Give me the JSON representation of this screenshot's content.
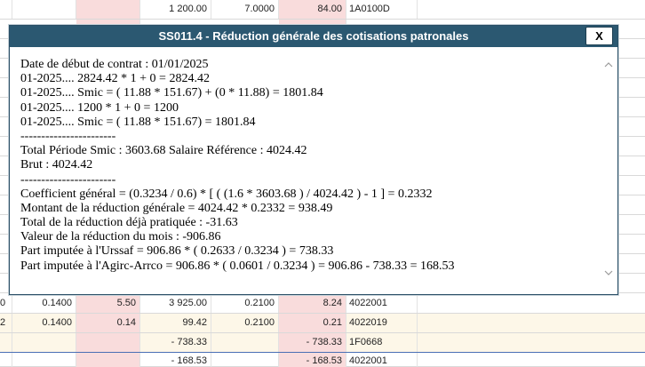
{
  "sheet": {
    "top_row": {
      "c0": "",
      "c3": "1 200.00",
      "c4": "7.0000",
      "c5": "84.00",
      "c6": "1A0100D"
    },
    "bottom_rows": [
      {
        "c0": "0",
        "c1": "0.1400",
        "c2": "5.50",
        "c3": "3 925.00",
        "c4": "0.2100",
        "c5": "8.24",
        "c6": "4022001"
      },
      {
        "c0": "2",
        "c1": "0.1400",
        "c2": "0.14",
        "c3": "99.42",
        "c4": "0.2100",
        "c5": "0.21",
        "c6": "4022019"
      },
      {
        "c0": "",
        "c1": "",
        "c2": "",
        "c3": "- 738.33",
        "c4": "",
        "c5": "- 738.33",
        "c6": "1F0668"
      },
      {
        "c0": "",
        "c1": "",
        "c2": "",
        "c3": "- 168.53",
        "c4": "",
        "c5": "- 168.53",
        "c6": "4022001"
      }
    ]
  },
  "dialog": {
    "title": "SS011.4 - Réduction générale des cotisations patronales",
    "close_label": "X",
    "lines": [
      "Date de début de contrat : 01/01/2025",
      "01-2025.... 2824.42 * 1 + 0 = 2824.42",
      "01-2025.... Smic = ( 11.88 * 151.67) + (0 * 11.88) = 1801.84",
      "01-2025.... 1200 * 1 + 0 = 1200",
      "01-2025.... Smic = ( 11.88 * 151.67) = 1801.84",
      "-----------------------",
      "Total Période Smic : 3603.68 Salaire Référence : 4024.42",
      "Brut : 4024.42",
      "-----------------------",
      "Coefficient général = (0.3234 / 0.6) * [ ( (1.6 * 3603.68 ) / 4024.42 ) - 1 ] = 0.2332",
      "Montant de la réduction générale = 4024.42 * 0.2332 = 938.49",
      "Total de la réduction déjà pratiquée : -31.63",
      "Valeur de la réduction du mois : -906.86",
      "Part imputée à l'Urssaf = 906.86 * ( 0.2633 / 0.3234 ) = 738.33",
      "Part imputée à l'Agirc-Arrco = 906.86 * ( 0.0601 / 0.3234 ) = 906.86 - 738.33 = 168.53"
    ]
  },
  "icons": {
    "scroll_up": "chevron-up-icon",
    "scroll_down": "chevron-down-icon"
  },
  "colors": {
    "titlebar": "#2b5871",
    "pink_cell": "#f9dcdc",
    "row_alt": "#fdf7e8"
  }
}
